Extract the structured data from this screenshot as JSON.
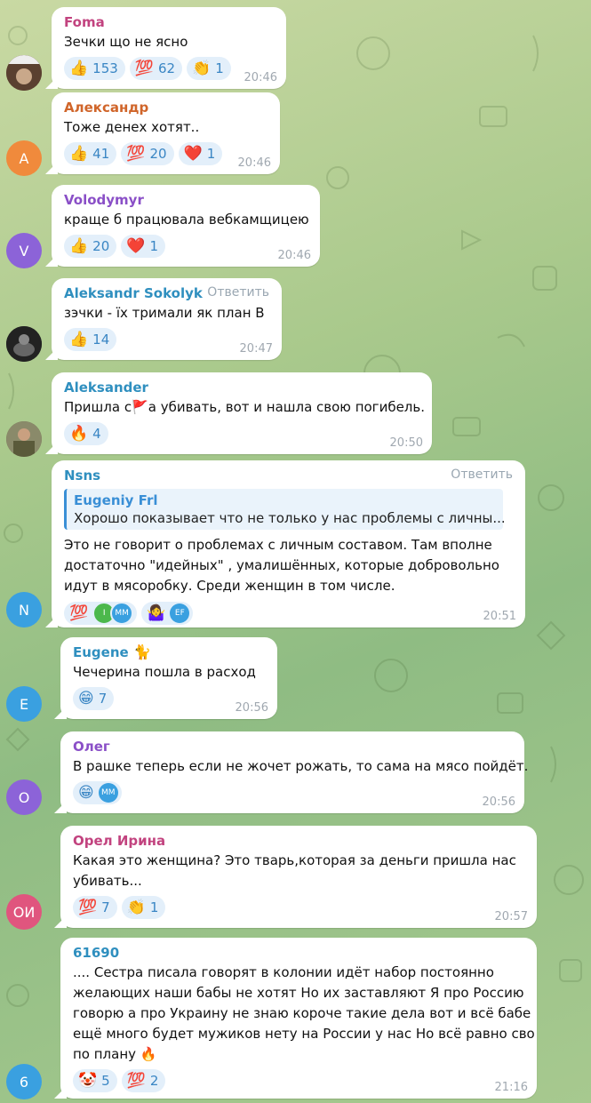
{
  "colors": {
    "reply": "#9aa7b2",
    "reaction_bg": "#e3effa",
    "reaction_text": "#3a86c4"
  },
  "messages": [
    {
      "name": "Foma",
      "name_color": "#c2437f",
      "avatar_text": "",
      "avatar_color": "#6b4f3a",
      "text": [
        "Зечки що не ясно"
      ],
      "time": "20:46",
      "reactions": [
        {
          "emoji": "👍",
          "count": "153"
        },
        {
          "emoji": "💯",
          "count": "62"
        },
        {
          "emoji": "👏",
          "count": "1"
        }
      ]
    },
    {
      "name": "Александр",
      "name_color": "#d0652a",
      "avatar_text": "А",
      "avatar_color": "#f08a3c",
      "text": [
        "Тоже денех хотят.."
      ],
      "time": "20:46",
      "reactions": [
        {
          "emoji": "👍",
          "count": "41"
        },
        {
          "emoji": "💯",
          "count": "20"
        },
        {
          "emoji": "❤️",
          "count": "1"
        }
      ]
    },
    {
      "name": "Volodymyr",
      "name_color": "#8a4fc7",
      "avatar_text": "V",
      "avatar_color": "#8c63d8",
      "text": [
        "краще б працювала вебкамщицею"
      ],
      "time": "20:46",
      "reactions": [
        {
          "emoji": "👍",
          "count": "20"
        },
        {
          "emoji": "❤️",
          "count": "1"
        }
      ]
    },
    {
      "name": "Aleksandr Sokolyk",
      "name_color": "#2f8fbf",
      "avatar_text": "",
      "avatar_color": "#2b2b2b",
      "reply": "Ответить",
      "text": [
        "зэчки - їх тримали як план В"
      ],
      "time": "20:47",
      "reactions": [
        {
          "emoji": "👍",
          "count": "14"
        }
      ]
    },
    {
      "name": "Aleksander",
      "name_color": "#2f8fbf",
      "avatar_text": "",
      "avatar_color": "#6a6048",
      "text": [
        "Пришла с🚩а убивать, вот и нашла свою погибель."
      ],
      "time": "20:50",
      "reactions": [
        {
          "emoji": "🔥",
          "count": "4"
        }
      ]
    },
    {
      "name": "Nsns",
      "name_color": "#2f8fbf",
      "avatar_text": "N",
      "avatar_color": "#3aa0e0",
      "reply": "Ответить",
      "quote": {
        "name": "Eugeniy Frl",
        "text": "Хорошо показывает что не только у нас проблемы с личны..."
      },
      "text": [
        "Это не говорит о проблемах с личным составом. Там вполне",
        "достаточно \"идейных\" , умалишённых, которые добровольно",
        "идут в мясоробку. Среди женщин в том числе."
      ],
      "time": "20:51",
      "mini_reactions": [
        {
          "emoji": "💯",
          "avatars": [
            {
              "t": "I",
              "c": "#4cb84c"
            },
            {
              "t": "MM",
              "c": "#3aa0e0"
            }
          ]
        },
        {
          "emoji": "🤷‍♀️",
          "avatars": [
            {
              "t": "EF",
              "c": "#3aa0e0"
            }
          ]
        }
      ]
    },
    {
      "name": "Eugene",
      "name_color": "#2f8fbf",
      "avatar_text": "E",
      "avatar_color": "#3aa0e0",
      "name_badge": "🐈",
      "text": [
        "Чечерина пошла в расход"
      ],
      "time": "20:56",
      "reactions": [
        {
          "emoji": "😁",
          "count": "7"
        }
      ]
    },
    {
      "name": "Олег",
      "name_color": "#8a4fc7",
      "avatar_text": "О",
      "avatar_color": "#8c63d8",
      "text": [
        "В рашке теперь если не жочет рожать, то сама на мясо пойдёт."
      ],
      "time": "20:56",
      "mini_reactions": [
        {
          "emoji": "😁",
          "avatars": [
            {
              "t": "MM",
              "c": "#3aa0e0"
            }
          ]
        }
      ]
    },
    {
      "name": "Орел Ирина",
      "name_color": "#c2437f",
      "avatar_text": "ОИ",
      "avatar_color": "#e0557e",
      "text": [
        "Какая это женщина? Это тварь,которая за деньги пришла нас",
        "убивать..."
      ],
      "time": "20:57",
      "reactions": [
        {
          "emoji": "💯",
          "count": "7"
        },
        {
          "emoji": "👏",
          "count": "1"
        }
      ]
    },
    {
      "name": "61690",
      "name_color": "#2f8fbf",
      "avatar_text": "6",
      "avatar_color": "#3aa0e0",
      "text": [
        ".... Сестра писала говорят в колонии идёт набор постоянно",
        "желающих наши бабы не хотят Но их заставляют Я про Россию",
        "говорю а про Украину не знаю короче такие дела вот и всё бабе",
        "ещё много будет мужиков нету на России у нас Но всё равно сво",
        "по плану 🔥"
      ],
      "time": "21:16",
      "reactions": [
        {
          "emoji": "🤡",
          "count": "5"
        },
        {
          "emoji": "💯",
          "count": "2"
        }
      ]
    }
  ]
}
